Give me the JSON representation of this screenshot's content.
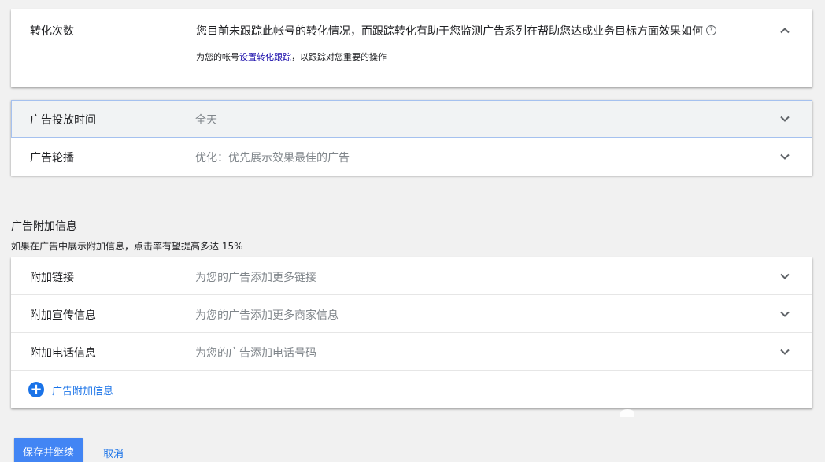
{
  "conversion": {
    "title": "转化次数",
    "message": "您目前未跟踪此帐号的转化情况，而跟踪转化有助于您监测广告系列在帮助您达成业务目标方面效果如何",
    "help_icon": "?",
    "sub_prefix": "为您的帐号",
    "sub_link": "设置转化跟踪",
    "sub_suffix": "，以跟踪对您重要的操作"
  },
  "schedule": {
    "rows": [
      {
        "label": "广告投放时间",
        "value": "全天"
      },
      {
        "label": "广告轮播",
        "value": "优化：优先展示效果最佳的广告"
      }
    ]
  },
  "extensions": {
    "title": "广告附加信息",
    "subtitle": "如果在广告中展示附加信息，点击率有望提高多达 15%",
    "rows": [
      {
        "label": "附加链接",
        "value": "为您的广告添加更多链接"
      },
      {
        "label": "附加宣传信息",
        "value": "为您的广告添加更多商家信息"
      },
      {
        "label": "附加电话信息",
        "value": "为您的广告添加电话号码"
      }
    ],
    "add_label": "广告附加信息",
    "add_icon": "+"
  },
  "actions": {
    "save_label": "保存并继续",
    "cancel_label": "取消"
  },
  "colors": {
    "accent": "#1a73e8",
    "primary_button": "#4285f4",
    "link": "#1a0dab",
    "muted_text": "#80868b"
  }
}
